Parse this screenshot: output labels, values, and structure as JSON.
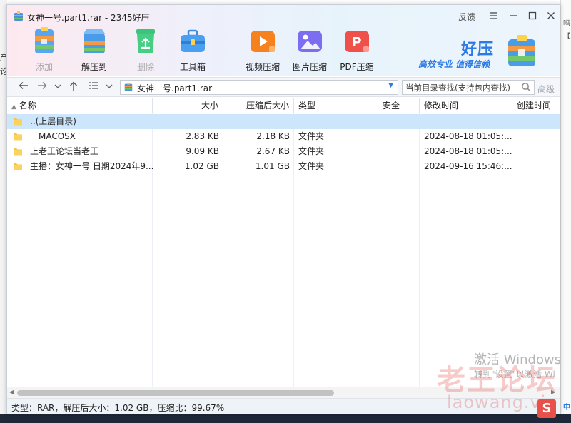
{
  "window": {
    "title": "女神一号.part1.rar - 2345好压",
    "feedback_label": "反馈",
    "menu_icon": "menu-icon",
    "minimize_icon": "minimize-icon",
    "maximize_icon": "maximize-icon",
    "close_icon": "close-icon"
  },
  "toolbar": {
    "add": "添加",
    "extract": "解压到",
    "delete": "删除",
    "toolbox": "工具箱",
    "video_compress": "视频压缩",
    "image_compress": "图片压缩",
    "pdf_compress": "PDF压缩"
  },
  "brand": {
    "name": "好压",
    "slogan": "高效专业  值得信赖",
    "accent": "#2c7be5"
  },
  "addressbar": {
    "path": "女神一号.part1.rar",
    "search_placeholder": "当前目录查找(支持包内查找)",
    "advanced": "高级"
  },
  "columns": {
    "name": "名称",
    "size": "大小",
    "packed": "压缩后大小",
    "type": "类型",
    "security": "安全",
    "modified": "修改时间",
    "created": "创建时间"
  },
  "rows": [
    {
      "name": "..(上层目录)",
      "size": "",
      "packed": "",
      "type": "",
      "security": "",
      "modified": "",
      "created": ""
    },
    {
      "name": "__MACOSX",
      "size": "2.83 KB",
      "packed": "2.18 KB",
      "type": "文件夹",
      "security": "",
      "modified": "2024-08-18 01:05:...",
      "created": ""
    },
    {
      "name": "上老王论坛当老王",
      "size": "9.09 KB",
      "packed": "2.67 KB",
      "type": "文件夹",
      "security": "",
      "modified": "2024-08-18 01:05:...",
      "created": ""
    },
    {
      "name": "主播：女神一号 日期2024年9...",
      "size": "1.02 GB",
      "packed": "1.01 GB",
      "type": "文件夹",
      "security": "",
      "modified": "2024-09-16 15:46:...",
      "created": ""
    }
  ],
  "statusbar": {
    "text": "类型：RAR，解压后大小：1.02 GB，压缩比：99.67%"
  },
  "overlays": {
    "activate_title": "激活 Windows",
    "activate_sub": "转到\"设置\"以激活 Wi",
    "watermark_cn": "老王论坛",
    "watermark_en": "laowang.vip"
  },
  "background": {
    "left_chars": [
      "产",
      "论"
    ],
    "right_chars": [
      "吗",
      "【系"
    ],
    "right_bottom": "中"
  }
}
